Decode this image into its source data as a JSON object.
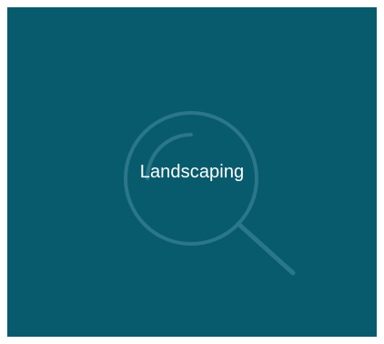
{
  "tile": {
    "label": "Landscaping",
    "icon": "search-icon",
    "background_color": "#085b6d",
    "text_color": "#ffffff"
  }
}
